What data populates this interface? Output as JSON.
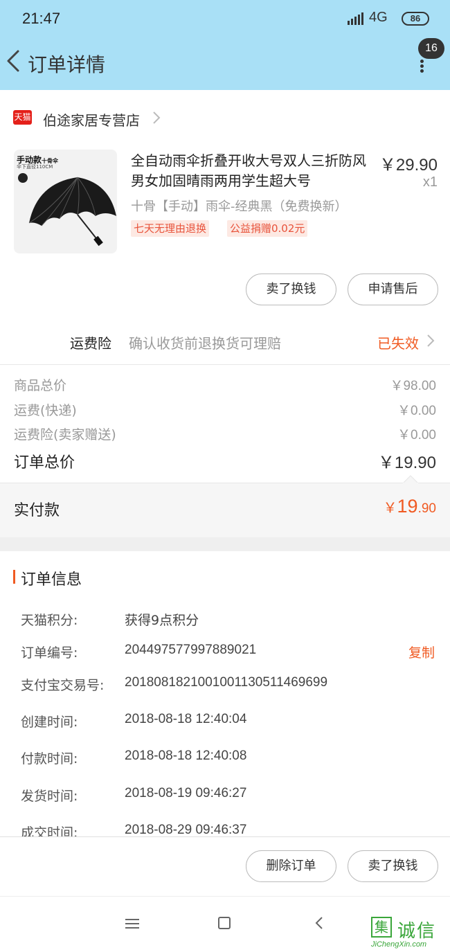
{
  "status_bar": {
    "time": "21:47",
    "network": "4G",
    "network_sub": "4G",
    "battery": "86"
  },
  "header": {
    "title": "订单详情",
    "badge_count": "16"
  },
  "store": {
    "logo_text": "天猫",
    "name": "伯途家居专营店"
  },
  "product": {
    "thumb_tag": "手动款",
    "thumb_tag_sub": "十骨伞",
    "thumb_tag_small": "伞下直径110CM",
    "name": "全自动雨伞折叠开收大号双人三折防风男女加固晴雨两用学生超大号",
    "price": "￥29.90",
    "quantity": "x1",
    "sku": "十骨【手动】雨伞-经典黑（免费换新）",
    "tags": [
      "七天无理由退换",
      "公益捐赠0.02元"
    ]
  },
  "product_actions": {
    "sell_label": "卖了换钱",
    "aftersale_label": "申请售后"
  },
  "insurance": {
    "label": "运费险",
    "desc": "确认收货前退换货可理赔",
    "status": "已失效"
  },
  "summary": {
    "rows": [
      {
        "label": "商品总价",
        "value": "￥98.00"
      },
      {
        "label": "运费(快递)",
        "value": "￥0.00"
      },
      {
        "label": "运费险(卖家赠送)",
        "value": "￥0.00"
      }
    ],
    "total_label": "订单总价",
    "total_value": "￥19.90",
    "paid_label": "实付款",
    "paid_currency": "￥",
    "paid_int": "19",
    "paid_dec": ".90"
  },
  "order_info": {
    "title": "订单信息",
    "copy_label": "复制",
    "rows": [
      {
        "key": "天猫积分:",
        "value": "获得9点积分"
      },
      {
        "key": "订单编号:",
        "value": "204497577997889021"
      },
      {
        "key": "支付宝交易号:",
        "value": "2018081821001001130511469699"
      },
      {
        "key": "创建时间:",
        "value": "2018-08-18 12:40:04"
      },
      {
        "key": "付款时间:",
        "value": "2018-08-18 12:40:08"
      },
      {
        "key": "发货时间:",
        "value": "2018-08-19 09:46:27"
      },
      {
        "key": "成交时间:",
        "value": "2018-08-29 09:46:37"
      }
    ]
  },
  "bottom_actions": {
    "delete_label": "删除订单",
    "sell_label": "卖了换钱"
  },
  "watermark": {
    "char_box": "集",
    "chars": "诚信",
    "domain": "JiChengXin.com"
  },
  "colors": {
    "header_bg": "#a9e0f6",
    "accent": "#f05a22",
    "tmall_red": "#e4201a"
  }
}
